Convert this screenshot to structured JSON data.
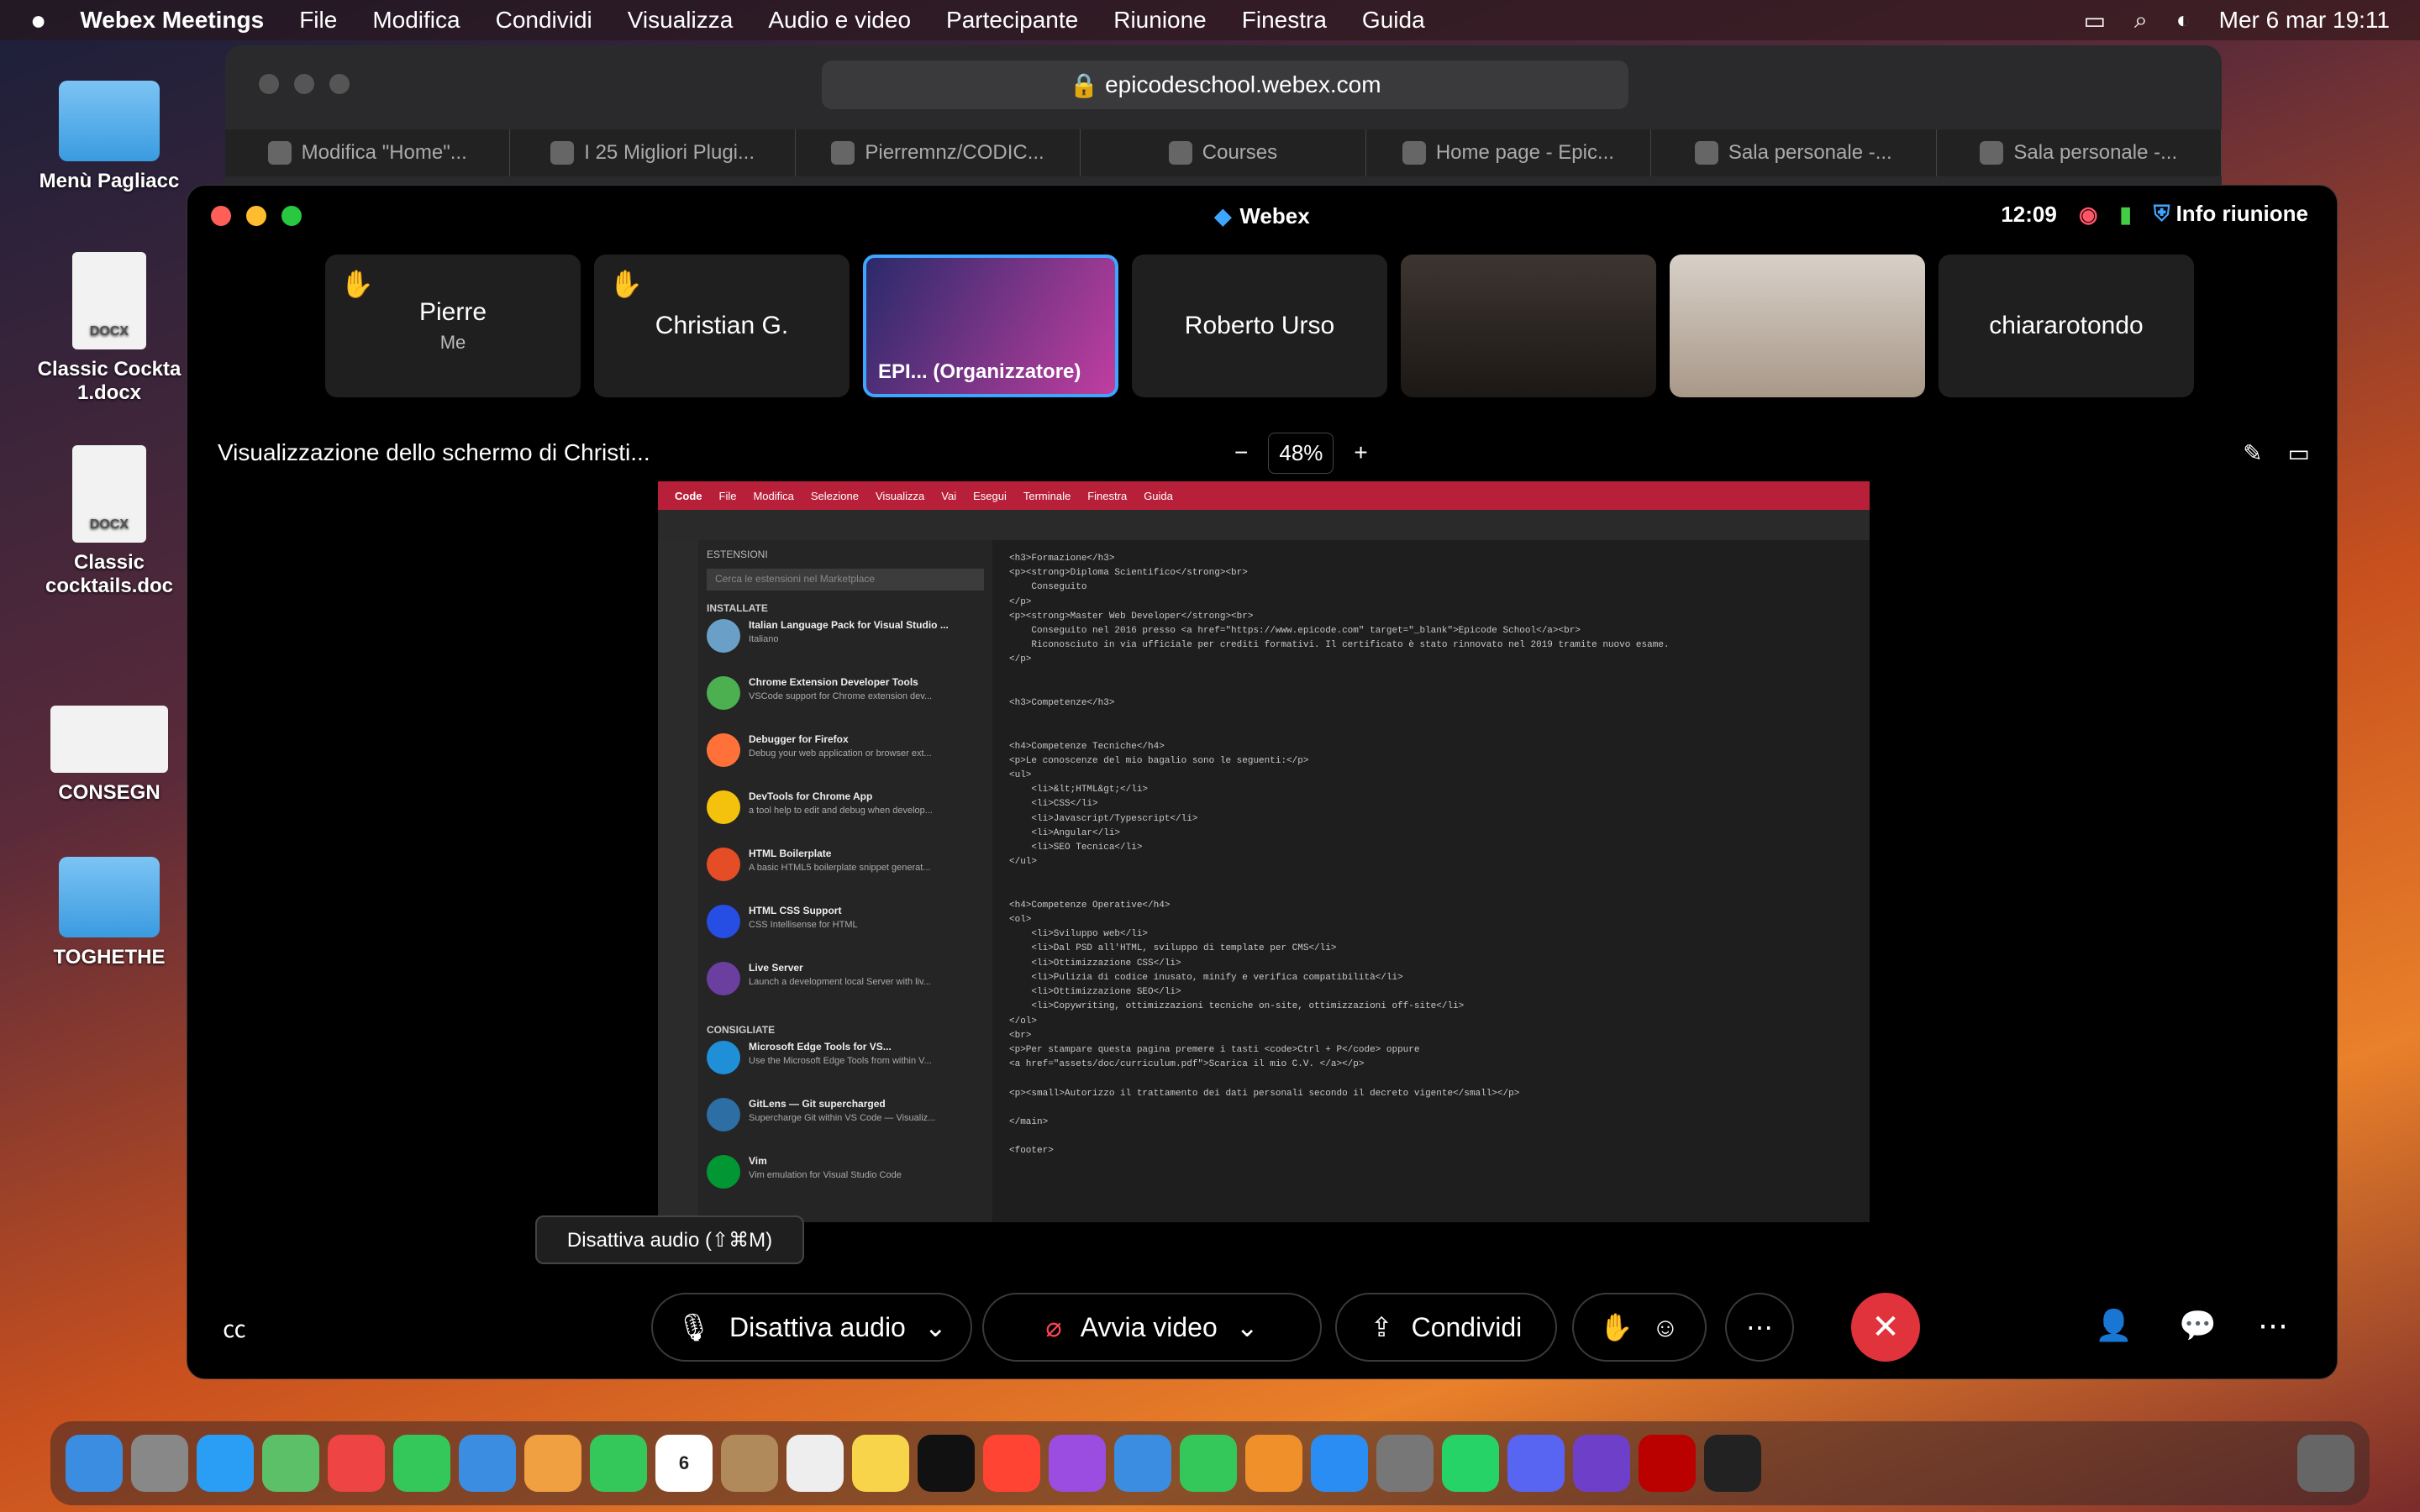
{
  "menubar": {
    "app": "Webex Meetings",
    "items": [
      "File",
      "Modifica",
      "Condividi",
      "Visualizza",
      "Audio e video",
      "Partecipante",
      "Riunione",
      "Finestra",
      "Guida"
    ],
    "datetime": "Mer 6 mar  19:11"
  },
  "desktop": {
    "icons": [
      "Menù Pagliacc",
      "Classic Cockta 1.docx",
      "Classic cocktails.doc",
      "CONSEGN",
      "TOGHETHE"
    ],
    "doc_badge": "DOCX"
  },
  "safari": {
    "url": "epicodeschool.webex.com",
    "tabs": [
      "Modifica \"Home\"...",
      "I 25 Migliori Plugi...",
      "Pierremnz/CODIC...",
      "Courses",
      "Home page - Epic...",
      "Sala personale -...",
      "Sala personale -..."
    ]
  },
  "webex": {
    "title": "Webex",
    "time": "12:09",
    "info": "Info riunione",
    "participants": [
      {
        "name": "Pierre",
        "sub": "Me"
      },
      {
        "name": "Christian G.",
        "sub": ""
      },
      {
        "name": "EPI...  (Organizzatore)",
        "sub": ""
      },
      {
        "name": "Roberto Urso",
        "sub": ""
      },
      {
        "name": "",
        "sub": ""
      },
      {
        "name": "",
        "sub": ""
      },
      {
        "name": "chiararotondo",
        "sub": ""
      }
    ],
    "share_title": "Visualizzazione dello schermo di Christi...",
    "zoom": "48%",
    "tooltip": "Disattiva audio (⇧⌘M)",
    "controls": {
      "audio": "Disattiva audio",
      "video": "Avvia video",
      "share": "Condividi"
    }
  },
  "vscode": {
    "menu": [
      "Code",
      "File",
      "Modifica",
      "Selezione",
      "Visualizza",
      "Vai",
      "Esegui",
      "Terminale",
      "Finestra",
      "Guida"
    ],
    "ext_header": "ESTENSIONI",
    "search": "Cerca le estensioni nel Marketplace",
    "installed": "INSTALLATE",
    "recommended": "CONSIGLIATE",
    "extensions": [
      {
        "name": "Italian Language Pack for Visual Studio ...",
        "desc": "Italiano",
        "color": "#6aa0c8"
      },
      {
        "name": "Chrome Extension Developer Tools",
        "desc": "VSCode support for Chrome extension dev...",
        "color": "#4caf50"
      },
      {
        "name": "Debugger for Firefox",
        "desc": "Debug your web application or browser ext...",
        "color": "#ff7139"
      },
      {
        "name": "DevTools for Chrome App",
        "desc": "a tool help to edit and debug when develop...",
        "color": "#f4c20d"
      },
      {
        "name": "HTML Boilerplate",
        "desc": "A basic HTML5 boilerplate snippet generat...",
        "color": "#e44d26"
      },
      {
        "name": "HTML CSS Support",
        "desc": "CSS Intellisense for HTML",
        "color": "#264de4"
      },
      {
        "name": "Live Server",
        "desc": "Launch a development local Server with liv...",
        "color": "#6a3fa0"
      },
      {
        "name": "Microsoft Edge Tools for VS...",
        "desc": "Use the Microsoft Edge Tools from within V...",
        "color": "#1f8fd8"
      },
      {
        "name": "GitLens — Git supercharged",
        "desc": "Supercharge Git within VS Code — Visualiz...",
        "color": "#2d6ea5"
      },
      {
        "name": "Vim",
        "desc": "Vim emulation for Visual Studio Code",
        "color": "#019733"
      }
    ],
    "code": "<h3>Formazione</h3>\n<p><strong>Diploma Scientifico</strong><br>\n    Conseguito\n</p>\n<p><strong>Master Web Developer</strong><br>\n    Conseguito nel 2016 presso <a href=\"https://www.epicode.com\" target=\"_blank\">Epicode School</a><br>\n    Riconosciuto in via ufficiale per crediti formativi. Il certificato è stato rinnovato nel 2019 tramite nuovo esame.\n</p>\n\n\n<h3>Competenze</h3>\n\n\n<h4>Competenze Tecniche</h4>\n<p>Le conoscenze del mio bagalio sono le seguenti:</p>\n<ul>\n    <li>&lt;HTML&gt;</li>\n    <li>CSS</li>\n    <li>Javascript/Typescript</li>\n    <li>Angular</li>\n    <li>SEO Tecnica</li>\n</ul>\n\n\n<h4>Competenze Operative</h4>\n<ol>\n    <li>Sviluppo web</li>\n    <li>Dal PSD all'HTML, sviluppo di template per CMS</li>\n    <li>Ottimizzazione CSS</li>\n    <li>Pulizia di codice inusato, minify e verifica compatibilità</li>\n    <li>Ottimizzazione SEO</li>\n    <li>Copywriting, ottimizzazioni tecniche on-site, ottimizzazioni off-site</li>\n</ol>\n<br>\n<p>Per stampare questa pagina premere i tasti <code>Ctrl + P</code> oppure\n<a href=\"assets/doc/curriculum.pdf\">Scarica il mio C.V. </a></p>\n\n<p><small>Autorizzo il trattamento dei dati personali secondo il decreto vigente</small></p>\n\n</main>\n\n<footer>"
  }
}
